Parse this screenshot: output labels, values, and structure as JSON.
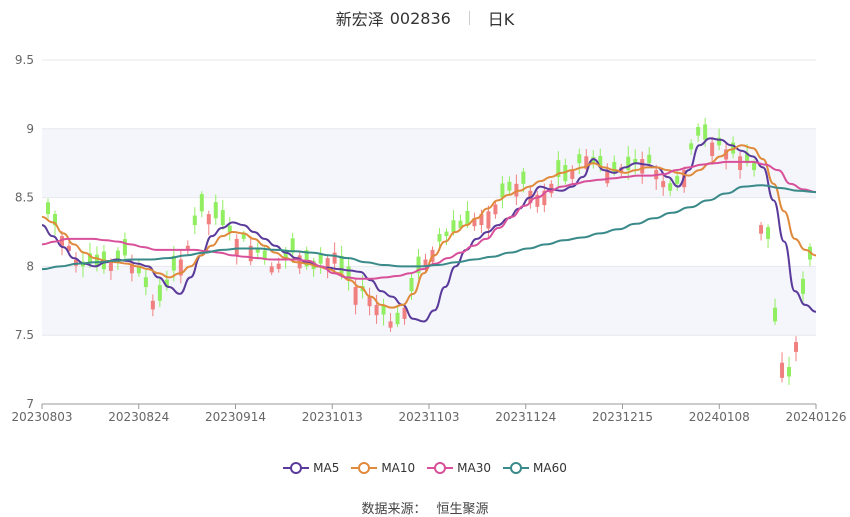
{
  "title": {
    "name": "新宏泽",
    "code": "002836",
    "period": "日K"
  },
  "source": {
    "label": "数据来源：",
    "value": "恒生聚源"
  },
  "chart_data": {
    "type": "candlestick",
    "ylim": [
      7,
      9.5
    ],
    "yticks": [
      "7",
      "7.5",
      "8",
      "8.5",
      "9",
      "9.5"
    ],
    "ytick_values": [
      7,
      7.5,
      8,
      8.5,
      9,
      9.5
    ],
    "xticks": [
      "20230803",
      "20230824",
      "20230914",
      "20231013",
      "20231103",
      "20231124",
      "20231215",
      "20240108",
      "20240126"
    ],
    "xtick_index": [
      0,
      15,
      30,
      45,
      60,
      75,
      90,
      105,
      120
    ],
    "band_fill": "#f4f6fc",
    "up_color": "#f08080",
    "down_color": "#90ee60",
    "closes": [
      8.38,
      8.3,
      8.22,
      8.15,
      8.05,
      8.0,
      8.02,
      8.0,
      7.98,
      8.03,
      8.05,
      8.08,
      8.02,
      7.95,
      7.85,
      7.75,
      7.75,
      7.85,
      7.97,
      8.05,
      8.15,
      8.3,
      8.4,
      8.38,
      8.35,
      8.3,
      8.25,
      8.2,
      8.2,
      8.15,
      8.1,
      8.05,
      8.0,
      8.02,
      8.05,
      8.1,
      8.08,
      8.0,
      7.98,
      8.02,
      8.06,
      8.1,
      7.95,
      7.9,
      7.85,
      7.82,
      7.78,
      7.72,
      7.65,
      7.6,
      7.58,
      7.7,
      7.82,
      7.95,
      8.05,
      8.12,
      8.18,
      8.22,
      8.25,
      8.28,
      8.3,
      8.35,
      8.38,
      8.4,
      8.45,
      8.5,
      8.55,
      8.6,
      8.6,
      8.55,
      8.52,
      8.55,
      8.6,
      8.65,
      8.62,
      8.7,
      8.75,
      8.8,
      8.75,
      8.72,
      8.7,
      8.68,
      8.72,
      8.7,
      8.75,
      8.78,
      8.75,
      8.7,
      8.62,
      8.55,
      8.6,
      8.7,
      8.85,
      8.95,
      8.92,
      8.9,
      8.88,
      8.85,
      8.82,
      8.8,
      8.75,
      8.7,
      8.3,
      8.2,
      7.6,
      7.3,
      7.2,
      7.45,
      7.8,
      8.05
    ],
    "series": [
      {
        "name": "MA5",
        "color": "#5a3a9a",
        "values": [
          8.3,
          8.22,
          8.14,
          8.06,
          8.02,
          8.0,
          8.03,
          8.05,
          8.04,
          8.02,
          8.0,
          7.92,
          7.85,
          7.8,
          7.92,
          8.08,
          8.22,
          8.28,
          8.32,
          8.3,
          8.25,
          8.2,
          8.15,
          8.1,
          8.06,
          8.03,
          8.0,
          7.99,
          7.98,
          7.97,
          7.96,
          7.9,
          7.82,
          7.78,
          7.72,
          7.62,
          7.6,
          7.68,
          7.85,
          8.0,
          8.12,
          8.2,
          8.25,
          8.3,
          8.35,
          8.42,
          8.5,
          8.58,
          8.56,
          8.55,
          8.58,
          8.65,
          8.78,
          8.7,
          8.68,
          8.72,
          8.75,
          8.74,
          8.72,
          8.65,
          8.58,
          8.7,
          8.88,
          8.93,
          8.92,
          8.88,
          8.84,
          8.8,
          8.72,
          8.48,
          8.18,
          7.82,
          7.72,
          7.67
        ]
      },
      {
        "name": "MA10",
        "color": "#e08a3c",
        "values": [
          8.36,
          8.32,
          8.24,
          8.16,
          8.1,
          8.06,
          8.04,
          8.03,
          8.02,
          8.0,
          7.98,
          7.95,
          7.92,
          7.95,
          8.0,
          8.08,
          8.15,
          8.22,
          8.25,
          8.24,
          8.2,
          8.15,
          8.1,
          8.06,
          8.03,
          8.02,
          8.0,
          7.98,
          7.95,
          7.9,
          7.85,
          7.78,
          7.72,
          7.7,
          7.72,
          7.8,
          7.95,
          8.08,
          8.18,
          8.25,
          8.3,
          8.35,
          8.42,
          8.48,
          8.52,
          8.55,
          8.58,
          8.62,
          8.65,
          8.68,
          8.7,
          8.72,
          8.75,
          8.72,
          8.7,
          8.68,
          8.7,
          8.72,
          8.72,
          8.7,
          8.68,
          8.66,
          8.7,
          8.75,
          8.8,
          8.85,
          8.88,
          8.86,
          8.78,
          8.6,
          8.4,
          8.2,
          8.12,
          8.08
        ]
      },
      {
        "name": "MA30",
        "color": "#d8509a",
        "values": [
          8.16,
          8.18,
          8.2,
          8.2,
          8.2,
          8.19,
          8.18,
          8.16,
          8.14,
          8.12,
          8.12,
          8.12,
          8.12,
          8.11,
          8.1,
          8.08,
          8.07,
          8.06,
          8.05,
          8.05,
          8.05,
          8.04,
          8.0,
          7.95,
          7.92,
          7.91,
          7.91,
          7.92,
          7.93,
          7.95,
          7.98,
          8.02,
          8.06,
          8.1,
          8.15,
          8.2,
          8.28,
          8.36,
          8.44,
          8.5,
          8.55,
          8.58,
          8.6,
          8.62,
          8.63,
          8.64,
          8.65,
          8.66,
          8.66,
          8.67,
          8.7,
          8.72,
          8.74,
          8.75,
          8.76,
          8.76,
          8.76,
          8.74,
          8.7,
          8.6,
          8.56,
          8.54
        ]
      },
      {
        "name": "MA60",
        "color": "#3a8a8a",
        "values": [
          7.98,
          8.0,
          8.02,
          8.03,
          8.04,
          8.05,
          8.05,
          8.06,
          8.08,
          8.1,
          8.12,
          8.13,
          8.13,
          8.12,
          8.11,
          8.1,
          8.08,
          8.06,
          8.03,
          8.01,
          8.0,
          8.0,
          8.01,
          8.03,
          8.05,
          8.07,
          8.1,
          8.13,
          8.16,
          8.19,
          8.21,
          8.24,
          8.27,
          8.31,
          8.35,
          8.39,
          8.43,
          8.48,
          8.53,
          8.58,
          8.59,
          8.57,
          8.55,
          8.54
        ]
      }
    ]
  }
}
